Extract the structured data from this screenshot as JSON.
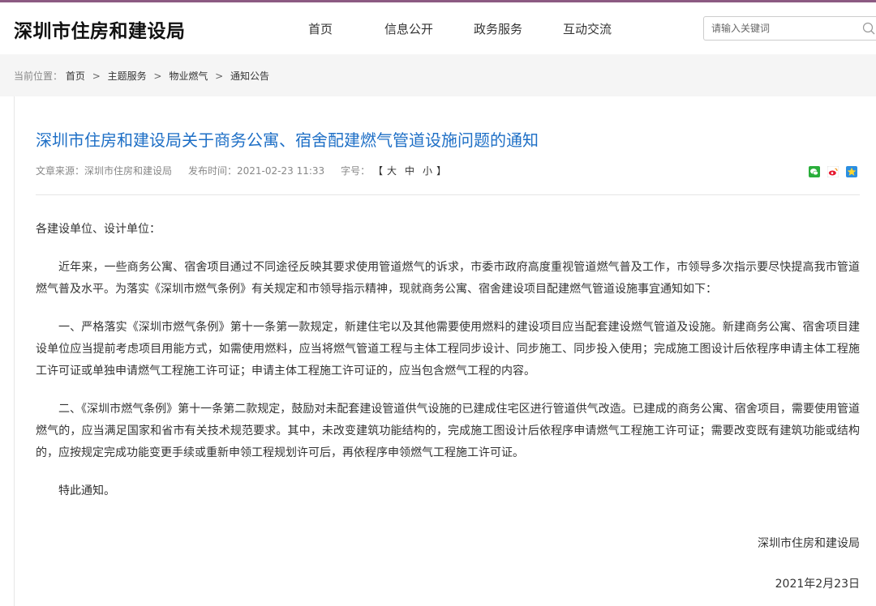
{
  "header": {
    "site_title": "深圳市住房和建设局",
    "nav": [
      {
        "label": "首页"
      },
      {
        "label": "信息公开"
      },
      {
        "label": "政务服务"
      },
      {
        "label": "互动交流"
      }
    ],
    "search": {
      "placeholder": "请输入关键词",
      "value": ""
    }
  },
  "breadcrumb": {
    "label": "当前位置：",
    "items": [
      "首页",
      "主题服务",
      "物业燃气",
      "通知公告"
    ],
    "separator": ">"
  },
  "article": {
    "title": "深圳市住房和建设局关于商务公寓、宿舍配建燃气管道设施问题的通知",
    "meta": {
      "source": "文章来源：深圳市住房和建设局",
      "published": "发布时间：2021-02-23 11:33",
      "font_size_label": "字号：",
      "bracket_open": "【",
      "bracket_close": "】",
      "sizes": [
        "大",
        "中",
        "小"
      ]
    },
    "share_icons": [
      "wechat-icon",
      "weibo-icon",
      "qzone-icon"
    ],
    "salutation": "各建设单位、设计单位：",
    "paragraphs": [
      "近年来，一些商务公寓、宿舍项目通过不同途径反映其要求使用管道燃气的诉求，市委市政府高度重视管道燃气普及工作，市领导多次指示要尽快提高我市管道燃气普及水平。为落实《深圳市燃气条例》有关规定和市领导指示精神，现就商务公寓、宿舍建设项目配建燃气管道设施事宜通知如下：",
      "一、严格落实《深圳市燃气条例》第十一条第一款规定，新建住宅以及其他需要使用燃料的建设项目应当配套建设燃气管道及设施。新建商务公寓、宿舍项目建设单位应当提前考虑项目用能方式，如需使用燃料，应当将燃气管道工程与主体工程同步设计、同步施工、同步投入使用；完成施工图设计后依程序申请主体工程施工许可证或单独申请燃气工程施工许可证；申请主体工程施工许可证的，应当包含燃气工程的内容。",
      "二、《深圳市燃气条例》第十一条第二款规定，鼓励对未配套建设管道供气设施的已建成住宅区进行管道供气改造。已建成的商务公寓、宿舍项目，需要使用管道燃气的，应当满足国家和省市有关技术规范要求。其中，未改变建筑功能结构的，完成施工图设计后依程序申请燃气工程施工许可证；需要改变既有建筑功能或结构的，应按规定完成功能变更手续或重新申领工程规划许可后，再依程序申领燃气工程施工许可证。",
      "特此通知。"
    ],
    "signature": {
      "org": "深圳市住房和建设局",
      "date": "2021年2月23日"
    }
  },
  "colors": {
    "accent_line": "#8c5a82",
    "title_blue": "#1e6fc6",
    "crumb_band": "#f5f5f5"
  }
}
